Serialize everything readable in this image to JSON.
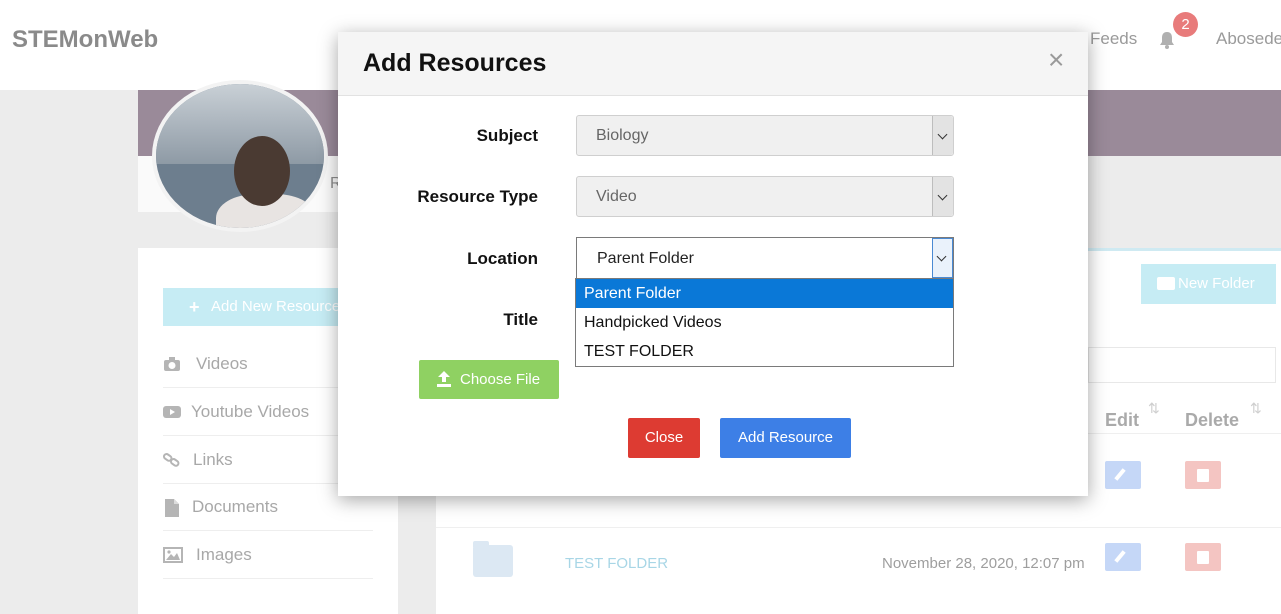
{
  "topbar": {
    "brand": "STEMonWeb",
    "feeds": "Feeds",
    "notif_count": "2",
    "user": "Abosede"
  },
  "profile": {
    "initial": "R"
  },
  "sidebar": {
    "add_button": "Add New Resource",
    "items": [
      {
        "label": "Videos",
        "icon": "camera-icon"
      },
      {
        "label": "Youtube Videos",
        "icon": "youtube-icon"
      },
      {
        "label": "Links",
        "icon": "link-icon"
      },
      {
        "label": "Documents",
        "icon": "document-icon"
      },
      {
        "label": "Images",
        "icon": "image-icon"
      }
    ]
  },
  "content": {
    "new_folder": "New Folder",
    "columns": {
      "edit": "Edit",
      "delete": "Delete"
    },
    "rows": [
      {
        "name": "TEST FOLDER",
        "date": "November 28, 2020, 12:07 pm"
      }
    ]
  },
  "modal": {
    "title": "Add Resources",
    "close_x": "×",
    "fields": {
      "subject_label": "Subject",
      "subject_value": "Biology",
      "type_label": "Resource Type",
      "type_value": "Video",
      "location_label": "Location",
      "location_value": "Parent Folder",
      "title_label": "Title"
    },
    "location_options": [
      "Parent Folder",
      "Handpicked Videos",
      "TEST FOLDER"
    ],
    "choose_file": "Choose File",
    "close_button": "Close",
    "add_button": "Add Resource"
  },
  "colors": {
    "accent_blue": "#3d7fe6",
    "danger_red": "#dd3b32",
    "success_green": "#8fd162",
    "select_highlight": "#0a78d7"
  }
}
